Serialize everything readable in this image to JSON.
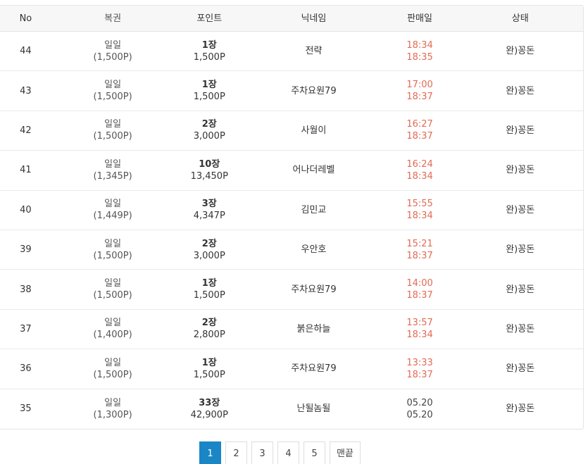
{
  "table": {
    "headers": {
      "no": "No",
      "ticket": "복권",
      "point": "포인트",
      "nickname": "닉네임",
      "sold": "판매일",
      "status": "상태"
    },
    "rows": [
      {
        "no": "44",
        "ticket": "일일",
        "ticket_price": "(1,500P)",
        "qty": "1장",
        "points": "1,500P",
        "nickname": "전략",
        "time1": "18:34",
        "time2": "18:35",
        "status": "완)꽁돈"
      },
      {
        "no": "43",
        "ticket": "일일",
        "ticket_price": "(1,500P)",
        "qty": "1장",
        "points": "1,500P",
        "nickname": "주차요원79",
        "time1": "17:00",
        "time2": "18:37",
        "status": "완)꽁돈"
      },
      {
        "no": "42",
        "ticket": "일일",
        "ticket_price": "(1,500P)",
        "qty": "2장",
        "points": "3,000P",
        "nickname": "사월이",
        "time1": "16:27",
        "time2": "18:37",
        "status": "완)꽁돈"
      },
      {
        "no": "41",
        "ticket": "일일",
        "ticket_price": "(1,345P)",
        "qty": "10장",
        "points": "13,450P",
        "nickname": "어나더레벨",
        "time1": "16:24",
        "time2": "18:34",
        "status": "완)꽁돈"
      },
      {
        "no": "40",
        "ticket": "일일",
        "ticket_price": "(1,449P)",
        "qty": "3장",
        "points": "4,347P",
        "nickname": "김민교",
        "time1": "15:55",
        "time2": "18:34",
        "status": "완)꽁돈"
      },
      {
        "no": "39",
        "ticket": "일일",
        "ticket_price": "(1,500P)",
        "qty": "2장",
        "points": "3,000P",
        "nickname": "우안호",
        "time1": "15:21",
        "time2": "18:37",
        "status": "완)꽁돈"
      },
      {
        "no": "38",
        "ticket": "일일",
        "ticket_price": "(1,500P)",
        "qty": "1장",
        "points": "1,500P",
        "nickname": "주차요원79",
        "time1": "14:00",
        "time2": "18:37",
        "status": "완)꽁돈"
      },
      {
        "no": "37",
        "ticket": "일일",
        "ticket_price": "(1,400P)",
        "qty": "2장",
        "points": "2,800P",
        "nickname": "붉은하늘",
        "time1": "13:57",
        "time2": "18:34",
        "status": "완)꽁돈"
      },
      {
        "no": "36",
        "ticket": "일일",
        "ticket_price": "(1,500P)",
        "qty": "1장",
        "points": "1,500P",
        "nickname": "주차요원79",
        "time1": "13:33",
        "time2": "18:37",
        "status": "완)꽁돈"
      },
      {
        "no": "35",
        "ticket": "일일",
        "ticket_price": "(1,300P)",
        "qty": "33장",
        "points": "42,900P",
        "nickname": "난될놈될",
        "time1": "05.20",
        "time2": "05.20",
        "status": "완)꽁돈"
      }
    ]
  },
  "pagination": {
    "pages": [
      "1",
      "2",
      "3",
      "4",
      "5"
    ],
    "current": "1",
    "last_label": "맨끝"
  },
  "colors": {
    "time_today": "#e26a55",
    "page_active": "#1a86c5"
  }
}
